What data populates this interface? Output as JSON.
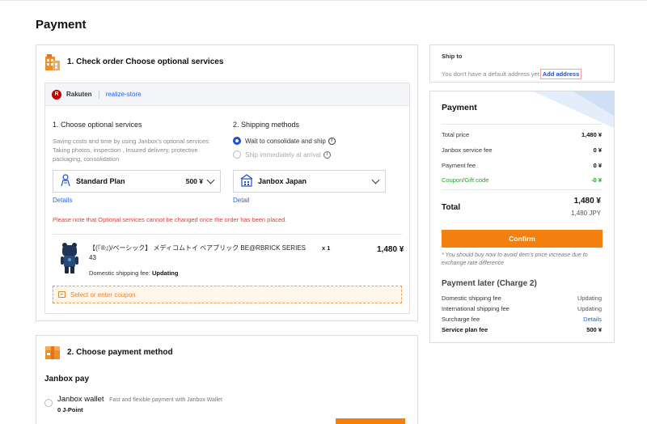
{
  "page": {
    "title": "Payment"
  },
  "check_order": {
    "title": "1. Check order Choose optional services",
    "store": {
      "logo_letter": "R",
      "marketplace": "Rakuten",
      "name": "realize-store"
    },
    "optional": {
      "title": "1. Choose optional services",
      "description": "Saving costs and time by using Janbox's optional services: Taking photos, inspection , Insured delivery, protective packaging, consolidation",
      "plan": "Standard Plan",
      "plan_price": "500 ¥",
      "details": "Details"
    },
    "shipping": {
      "title": "2. Shipping methods",
      "option1": "Wait to consolidate and ship",
      "option2": "Ship immediately at arrival",
      "method": "Janbox Japan",
      "detail": "Detail"
    },
    "warning": "Please note that Optional services cannot be changed once the order has been placed.",
    "product": {
      "name": "【(『®』)/ベーシック】 メディコムトイ ベアブリック BE@RBRICK SERIES 43",
      "qty": "x 1",
      "price": "1,480 ¥",
      "ship_fee_label": "Domestic shipping fee:",
      "ship_fee_value": "Updating"
    },
    "coupon": "Select or enter coupon"
  },
  "payment_method": {
    "title": "2. Choose payment method",
    "subtitle": "Janbox pay",
    "wallet_name": "Janbox wallet",
    "wallet_desc": "Fast and flexible payment with Janbox Wallet",
    "wallet_points": "0 J-Point"
  },
  "ship_to": {
    "label": "Ship to",
    "text": "You don't have a default address yet",
    "add_link": "Add address"
  },
  "summary": {
    "title": "Payment",
    "rows": [
      {
        "label": "Total price",
        "value": "1,480 ¥"
      },
      {
        "label": "Janbox service fee",
        "value": "0 ¥"
      },
      {
        "label": "Payment fee",
        "value": "0 ¥"
      },
      {
        "label": "Coupon/Gift code",
        "value": "-0 ¥"
      }
    ],
    "total_label": "Total",
    "total_value": "1,480 ¥",
    "total_jpy": "1,480 JPY",
    "confirm": "Confirm",
    "note": "* You should buy now to avoid item's price increase due to exchange rate difference",
    "later_title": "Payment later (Charge 2)",
    "later_rows": [
      {
        "label": "Domestic shipping fee",
        "value": "Updating"
      },
      {
        "label": "International shipping fee",
        "value": "Updating"
      },
      {
        "label": "Surcharge fee",
        "value": "Details"
      },
      {
        "label": "Service plan fee",
        "value": "500 ¥"
      }
    ]
  },
  "colors": {
    "accent": "#f37f0e",
    "link": "#2563eb",
    "success": "#22a02a",
    "warning": "#e53935"
  },
  "icons": [
    "building-icon",
    "box-icon",
    "rakuten-logo",
    "bear-product-image",
    "coupon-icon",
    "info-icon",
    "chevron-down-icon",
    "radio-icon"
  ]
}
